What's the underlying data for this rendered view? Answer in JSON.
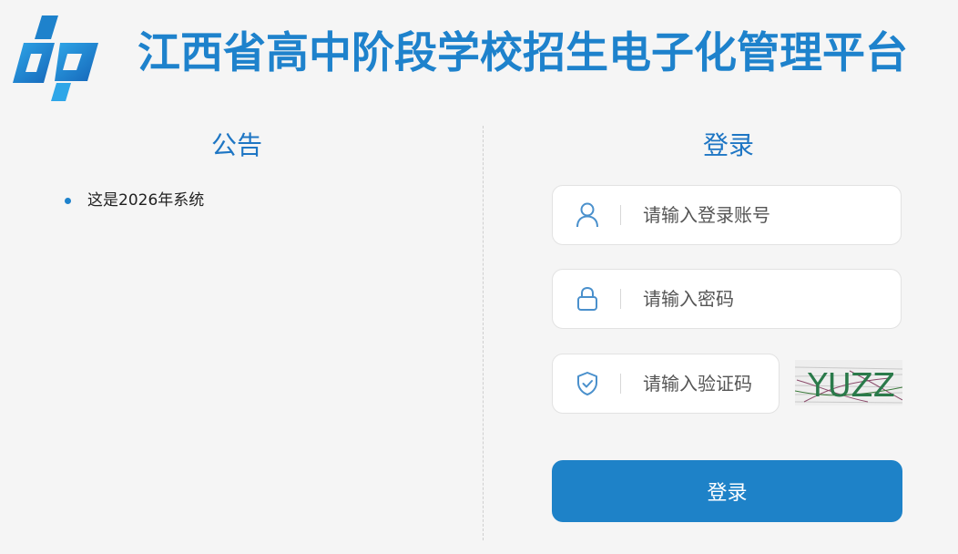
{
  "header": {
    "logo_icon": "platform-logo-icon",
    "title": "江西省高中阶段学校招生电子化管理平台"
  },
  "notice": {
    "title": "公告",
    "items": [
      {
        "text": "这是2026年系统"
      }
    ]
  },
  "login": {
    "title": "登录",
    "account": {
      "icon": "user-icon",
      "value": "",
      "placeholder": "请输入登录账号"
    },
    "password": {
      "icon": "lock-icon",
      "value": "",
      "placeholder": "请输入密码"
    },
    "captcha": {
      "icon": "shield-check-icon",
      "value": "",
      "placeholder": "请输入验证码",
      "image_text": "YUZZ"
    },
    "submit_label": "登录"
  },
  "colors": {
    "brand": "#1e82cc",
    "title_blue": "#1e76c4",
    "button": "#1e82c8",
    "background": "#f5f5f5"
  }
}
